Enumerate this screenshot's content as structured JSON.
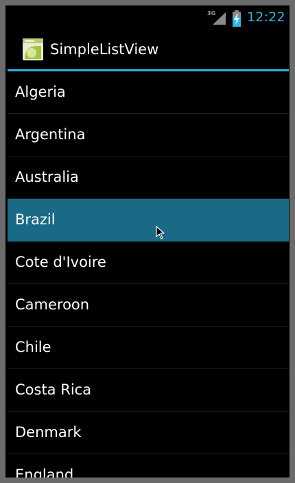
{
  "status_bar": {
    "network_type": "3G",
    "time": "12:22",
    "icons": [
      "signal-icon",
      "battery-charging-icon"
    ],
    "accent_color": "#33b5e5"
  },
  "action_bar": {
    "app_icon": "android-app-icon",
    "title": "SimpleListView"
  },
  "list": {
    "selected_index": 3,
    "selected_color": "#196a86",
    "items": [
      {
        "label": "Algeria"
      },
      {
        "label": "Argentina"
      },
      {
        "label": "Australia"
      },
      {
        "label": "Brazil"
      },
      {
        "label": "Cote d'Ivoire"
      },
      {
        "label": "Cameroon"
      },
      {
        "label": "Chile"
      },
      {
        "label": "Costa Rica"
      },
      {
        "label": "Denmark"
      },
      {
        "label": "England"
      }
    ]
  },
  "pointer": {
    "icon": "mouse-cursor-icon"
  }
}
